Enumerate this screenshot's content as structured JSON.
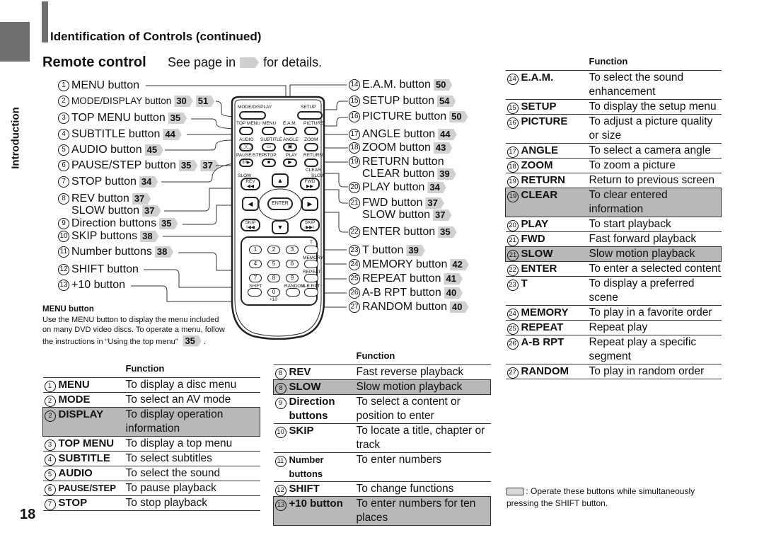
{
  "side_label": "Introduction",
  "section_title": "Identification of Controls (continued)",
  "subtitle": "Remote control",
  "see_page": {
    "before": "See page in",
    "after": "for details."
  },
  "left_labels": [
    {
      "n": "1",
      "text": "MENU button",
      "refs": []
    },
    {
      "n": "2",
      "text": "MODE/DISPLAY button",
      "refs": [
        "30",
        "51"
      ]
    },
    {
      "n": "3",
      "text": "TOP MENU button",
      "refs": [
        "35"
      ]
    },
    {
      "n": "4",
      "text": "SUBTITLE button",
      "refs": [
        "44"
      ]
    },
    {
      "n": "5",
      "text": "AUDIO button",
      "refs": [
        "45"
      ]
    },
    {
      "n": "6",
      "text": "PAUSE/STEP button",
      "refs": [
        "35",
        "37"
      ]
    },
    {
      "n": "7",
      "text": "STOP button",
      "refs": [
        "34"
      ]
    },
    {
      "n": "8",
      "text": "REV button",
      "refs": [
        "37"
      ]
    },
    {
      "n": "",
      "text": "SLOW button",
      "refs": [
        "37"
      ]
    },
    {
      "n": "9",
      "text": "Direction buttons",
      "refs": [
        "35"
      ]
    },
    {
      "n": "10",
      "text": "SKIP buttons",
      "refs": [
        "38"
      ]
    },
    {
      "n": "11",
      "text": "Number buttons",
      "refs": [
        "38"
      ]
    },
    {
      "n": "12",
      "text": "SHIFT button",
      "refs": []
    },
    {
      "n": "13",
      "text": "+10 button",
      "refs": []
    }
  ],
  "right_labels": [
    {
      "n": "14",
      "text": "E.A.M. button",
      "refs": [
        "50"
      ]
    },
    {
      "n": "15",
      "text": "SETUP button",
      "refs": [
        "54"
      ]
    },
    {
      "n": "16",
      "text": "PICTURE button",
      "refs": [
        "50"
      ]
    },
    {
      "n": "17",
      "text": "ANGLE button",
      "refs": [
        "44"
      ]
    },
    {
      "n": "18",
      "text": "ZOOM button",
      "refs": [
        "43"
      ]
    },
    {
      "n": "19",
      "text": "RETURN button",
      "refs": []
    },
    {
      "n": "",
      "text": "CLEAR button",
      "refs": [
        "39"
      ]
    },
    {
      "n": "20",
      "text": "PLAY button",
      "refs": [
        "34"
      ]
    },
    {
      "n": "21",
      "text": "FWD button",
      "refs": [
        "37"
      ]
    },
    {
      "n": "",
      "text": "SLOW button",
      "refs": [
        "37"
      ]
    },
    {
      "n": "22",
      "text": "ENTER button",
      "refs": [
        "35"
      ]
    },
    {
      "n": "23",
      "text": "T button",
      "refs": [
        "39"
      ]
    },
    {
      "n": "24",
      "text": "MEMORY button",
      "refs": [
        "42"
      ]
    },
    {
      "n": "25",
      "text": "REPEAT button",
      "refs": [
        "41"
      ]
    },
    {
      "n": "26",
      "text": "A-B RPT button",
      "refs": [
        "40"
      ]
    },
    {
      "n": "27",
      "text": "RANDOM button",
      "refs": [
        "40"
      ]
    }
  ],
  "remote": {
    "mode_display": "MODE/DISPLAY",
    "setup": "SETUP",
    "top_menu": "TOP MENU",
    "menu": "MENU",
    "eam": "E.A.M.",
    "picture": "PICTURE",
    "audio": "AUDIO",
    "subtitle": "SUBTITLE",
    "angle": "ANGLE",
    "zoom": "ZOOM",
    "pause_step": "PAUSE/STEP",
    "stop": "STOP",
    "play": "PLAY",
    "return": "RETURN",
    "clear": "CLEAR",
    "slow": "SLOW",
    "rev": "REV",
    "fwd": "FWD",
    "enter": "ENTER",
    "skip": "SKIP",
    "numbers": [
      "1",
      "2",
      "3",
      "4",
      "5",
      "6",
      "7",
      "8",
      "9",
      "0"
    ],
    "t": "T",
    "memory": "MEMORY",
    "repeat": "REPEAT",
    "shift": "SHIFT",
    "random": "RANDOM",
    "ab_rpt": "A-B RPT",
    "plus10": "+10"
  },
  "menu_note": {
    "heading": "MENU button",
    "body": "Use the MENU button to display the menu included on many DVD video discs. To operate a menu, follow the instructions in “Using the top menu”",
    "ref": "35"
  },
  "function_header": "Function",
  "table1": [
    {
      "n": "1",
      "key": "MENU",
      "fn": "To display a disc menu",
      "shift": false
    },
    {
      "n": "2",
      "key": "MODE",
      "fn": "To select an AV mode",
      "shift": false
    },
    {
      "n": "2",
      "key": "DISPLAY",
      "fn": "To display operation information",
      "shift": true
    },
    {
      "n": "3",
      "key": "TOP MENU",
      "fn": "To display a top menu",
      "shift": false
    },
    {
      "n": "4",
      "key": "SUBTITLE",
      "fn": "To select subtitles",
      "shift": false
    },
    {
      "n": "5",
      "key": "AUDIO",
      "fn": "To select the sound",
      "shift": false
    },
    {
      "n": "6",
      "key": "PAUSE/STEP",
      "fn": "To pause playback",
      "shift": false
    },
    {
      "n": "7",
      "key": "STOP",
      "fn": "To stop playback",
      "shift": false
    }
  ],
  "table2": [
    {
      "n": "8",
      "key": "REV",
      "fn": "Fast reverse playback",
      "shift": false
    },
    {
      "n": "8",
      "key": "SLOW",
      "fn": "Slow motion playback",
      "shift": true
    },
    {
      "n": "9",
      "key": "Direction buttons",
      "fn": "To select a content or position to enter",
      "shift": false
    },
    {
      "n": "10",
      "key": "SKIP",
      "fn": "To locate a title, chapter or track",
      "shift": false
    },
    {
      "n": "11",
      "key": "Number buttons",
      "fn": "To enter numbers",
      "shift": false
    },
    {
      "n": "12",
      "key": "SHIFT",
      "fn": "To change functions",
      "shift": false
    },
    {
      "n": "13",
      "key": "+10 button",
      "fn": "To enter numbers for ten places",
      "shift": true
    }
  ],
  "table3": [
    {
      "n": "14",
      "key": "E.A.M.",
      "fn": "To select the sound enhancement",
      "shift": false
    },
    {
      "n": "15",
      "key": "SETUP",
      "fn": "To display the setup menu",
      "shift": false
    },
    {
      "n": "16",
      "key": "PICTURE",
      "fn": "To adjust a picture quality or size",
      "shift": false
    },
    {
      "n": "17",
      "key": "ANGLE",
      "fn": "To select a camera angle",
      "shift": false
    },
    {
      "n": "18",
      "key": "ZOOM",
      "fn": "To zoom a picture",
      "shift": false
    },
    {
      "n": "19",
      "key": "RETURN",
      "fn": "Return to previous screen",
      "shift": false
    },
    {
      "n": "19",
      "key": "CLEAR",
      "fn": "To clear entered information",
      "shift": true
    },
    {
      "n": "20",
      "key": "PLAY",
      "fn": "To start playback",
      "shift": false
    },
    {
      "n": "21",
      "key": "FWD",
      "fn": "Fast forward playback",
      "shift": false
    },
    {
      "n": "21",
      "key": "SLOW",
      "fn": "Slow motion playback",
      "shift": true
    },
    {
      "n": "22",
      "key": "ENTER",
      "fn": "To enter a selected content",
      "shift": false
    },
    {
      "n": "23",
      "key": "T",
      "fn": "To display a preferred scene",
      "shift": false
    },
    {
      "n": "24",
      "key": "MEMORY",
      "fn": "To play in a favorite order",
      "shift": false
    },
    {
      "n": "25",
      "key": "REPEAT",
      "fn": "Repeat play",
      "shift": false
    },
    {
      "n": "26",
      "key": "A-B RPT",
      "fn": "Repeat play a specific segment",
      "shift": false
    },
    {
      "n": "27",
      "key": "RANDOM",
      "fn": "To play in random order",
      "shift": false
    }
  ],
  "legend": ": Operate these buttons while simultaneously pressing the SHIFT button.",
  "page_number": "18"
}
